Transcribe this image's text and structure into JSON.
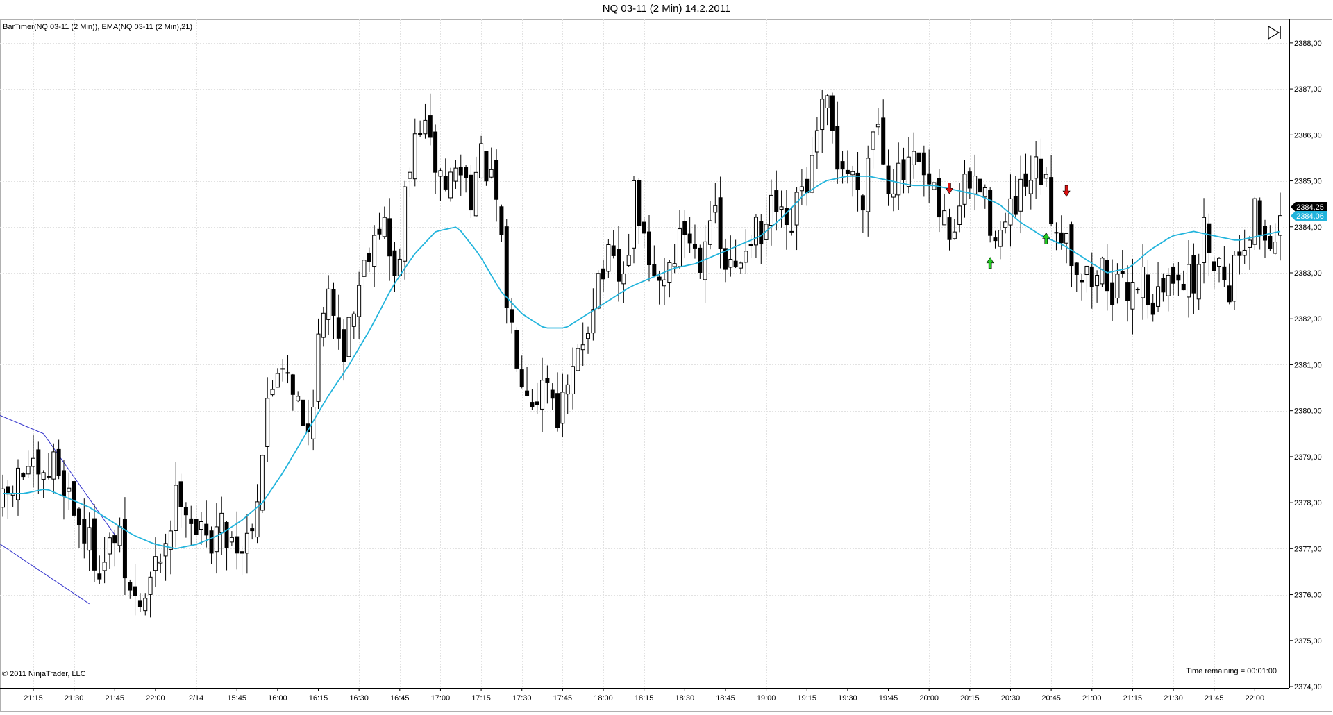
{
  "window": {
    "title": "NQ 03-11 (2 Min)  14.2.2011"
  },
  "indicator_label": "BarTimer(NQ 03-11 (2 Min)), EMA(NQ 03-11 (2 Min),21)",
  "copyright": "© 2011 NinjaTrader, LLC",
  "time_remaining": "Time remaining = 00:01:00",
  "price_axis_ticks": [
    "2388,00",
    "2387,00",
    "2386,00",
    "2385,00",
    "2384,00",
    "2383,00",
    "2382,00",
    "2381,00",
    "2380,00",
    "2379,00",
    "2378,00",
    "2377,00",
    "2376,00",
    "2375,00",
    "2374,00"
  ],
  "last_price_label": "2384,25",
  "ema_value_label": "2384,06",
  "colors": {
    "ema_line": "#22b4dc",
    "channel_lines": "#3333cc",
    "sell_arrow": "#dd1111",
    "buy_arrow": "#22cc22",
    "grid": "#e2e2e2",
    "candle_outline": "#000000"
  },
  "icons": [
    "play-to-end-icon",
    "sell-arrow-icon",
    "buy-arrow-icon"
  ],
  "chart_data": {
    "type": "candlestick",
    "instrument": "NQ 03-11",
    "timeframe": "2 Min",
    "date": "14.2.2011",
    "ylim": [
      2374.0,
      2388.3
    ],
    "x_tick_labels": [
      "21:15",
      "21:30",
      "21:45",
      "22:00",
      "2/14",
      "15:45",
      "16:00",
      "16:15",
      "16:30",
      "16:45",
      "17:00",
      "17:15",
      "17:30",
      "17:45",
      "18:00",
      "18:15",
      "18:30",
      "18:45",
      "19:00",
      "19:15",
      "19:30",
      "19:45",
      "20:00",
      "20:15",
      "20:30",
      "20:45",
      "21:00",
      "21:15",
      "21:30",
      "21:45",
      "22:00"
    ],
    "bar_count": 252,
    "close_path": [
      2377.9,
      2378.4,
      2378.8,
      2378.2,
      2378.9,
      2378.4,
      2377.6,
      2377.0,
      2376.6,
      2377.4,
      2376.0,
      2375.7,
      2376.5,
      2377.3,
      2378.4,
      2377.6,
      2377.1,
      2377.5,
      2377.3,
      2377.0,
      2378.0,
      2380.2,
      2381.3,
      2380.6,
      2379.2,
      2381.6,
      2382.5,
      2381.4,
      2382.6,
      2383.7,
      2384.3,
      2382.7,
      2385.0,
      2386.3,
      2385.5,
      2384.9,
      2385.3,
      2384.8,
      2385.5,
      2384.5,
      2382.0,
      2381.0,
      2380.3,
      2380.8,
      2379.9,
      2380.6,
      2381.7,
      2382.9,
      2383.2,
      2382.6,
      2384.8,
      2383.0,
      2382.8,
      2383.4,
      2384.0,
      2383.3,
      2384.5,
      2383.1,
      2383.0,
      2384.0,
      2383.6,
      2384.5,
      2383.6,
      2384.6,
      2385.3,
      2386.7,
      2385.5,
      2385.1,
      2384.8,
      2386.6,
      2385.1,
      2385.0,
      2385.3,
      2384.9,
      2384.3,
      2383.8,
      2384.8,
      2385.0,
      2384.2,
      2383.8,
      2384.4,
      2384.8,
      2385.2,
      2384.2,
      2383.9,
      2383.1,
      2382.8,
      2383.1,
      2382.5,
      2382.7,
      2383.0,
      2382.3,
      2382.7,
      2383.2,
      2382.6,
      2383.9,
      2383.3,
      2382.8,
      2383.7,
      2384.3,
      2383.6,
      2384.2
    ],
    "ema21": [
      2378.2,
      2378.2,
      2378.3,
      2378.1,
      2377.9,
      2377.6,
      2377.3,
      2377.1,
      2377.0,
      2377.1,
      2377.3,
      2377.6,
      2378.0,
      2378.7,
      2379.5,
      2380.3,
      2381.0,
      2381.8,
      2382.7,
      2383.4,
      2383.9,
      2384.0,
      2383.4,
      2382.6,
      2382.1,
      2381.8,
      2381.8,
      2382.1,
      2382.4,
      2382.7,
      2382.9,
      2383.1,
      2383.2,
      2383.4,
      2383.6,
      2383.8,
      2384.2,
      2384.7,
      2385.0,
      2385.1,
      2385.1,
      2385.0,
      2384.9,
      2384.9,
      2384.8,
      2384.7,
      2384.5,
      2384.1,
      2383.8,
      2383.6,
      2383.3,
      2383.0,
      2383.1,
      2383.5,
      2383.8,
      2383.9,
      2383.8,
      2383.7,
      2383.8,
      2383.9
    ],
    "signals": [
      {
        "type": "sell",
        "time": "20:02"
      },
      {
        "type": "buy",
        "time": "20:22"
      },
      {
        "type": "buy",
        "time": "20:48"
      },
      {
        "type": "sell",
        "time": "20:54"
      }
    ],
    "channel": {
      "upper_start": 2379.9,
      "upper_end": 2377.3,
      "lower_start": 2377.1,
      "lower_end": 2375.8
    },
    "grid": true
  }
}
